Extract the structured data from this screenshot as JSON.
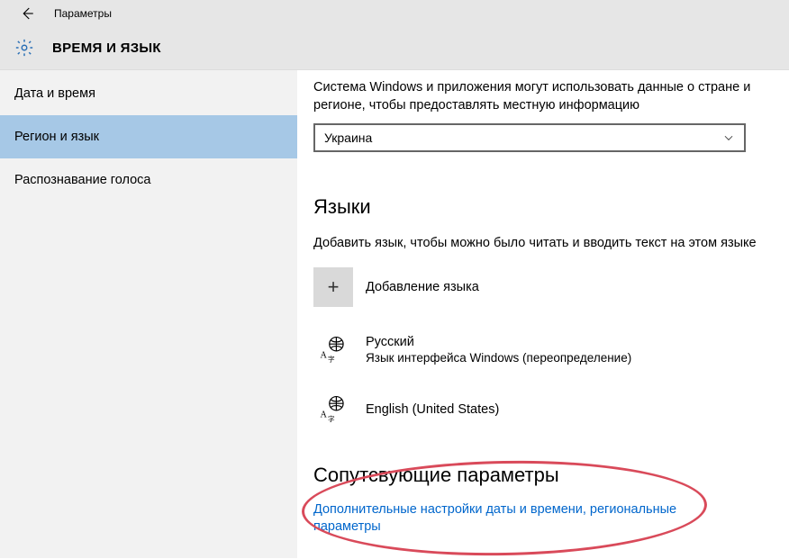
{
  "header": {
    "window_title": "Параметры",
    "section_title": "ВРЕМЯ И ЯЗЫК"
  },
  "sidebar": {
    "items": [
      {
        "label": "Дата и время",
        "selected": false
      },
      {
        "label": "Регион и язык",
        "selected": true
      },
      {
        "label": "Распознавание голоса",
        "selected": false
      }
    ]
  },
  "content": {
    "region_desc": "Система Windows и приложения могут использовать данные о стране и регионе, чтобы предоставлять местную информацию",
    "region_dropdown": "Украина",
    "languages_heading": "Языки",
    "languages_desc": "Добавить язык, чтобы можно было читать и вводить текст на этом языке",
    "add_language_label": "Добавление языка",
    "languages": [
      {
        "name": "Русский",
        "sub": "Язык интерфейса Windows (переопределение)"
      },
      {
        "name": "English (United States)",
        "sub": ""
      }
    ],
    "related_heading": "Сопутсвующие параметры",
    "related_link": "Дополнительные настройки даты и времени, региональные параметры"
  }
}
